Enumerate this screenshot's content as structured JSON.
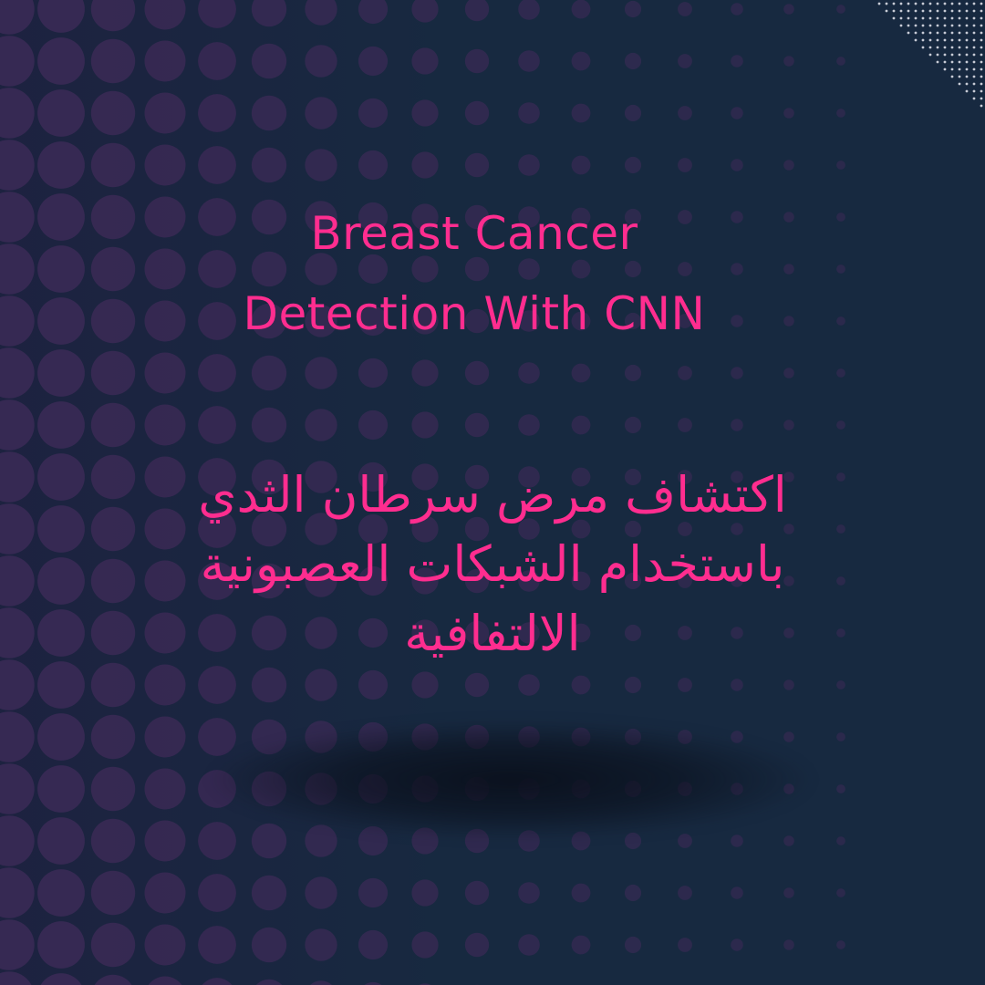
{
  "colors": {
    "background": "#172940",
    "accent_pink": "#ff2d8f",
    "halftone_purple": "#3a2a55",
    "corner_dots": "#c8ccd6"
  },
  "title_en": {
    "line1": "Breast Cancer",
    "line2": "Detection With CNN"
  },
  "title_ar": {
    "line1": "اكتشاف مرض سرطان الثدي",
    "line2": "باستخدام الشبكات العصبونية",
    "line3": "الالتفافية"
  }
}
